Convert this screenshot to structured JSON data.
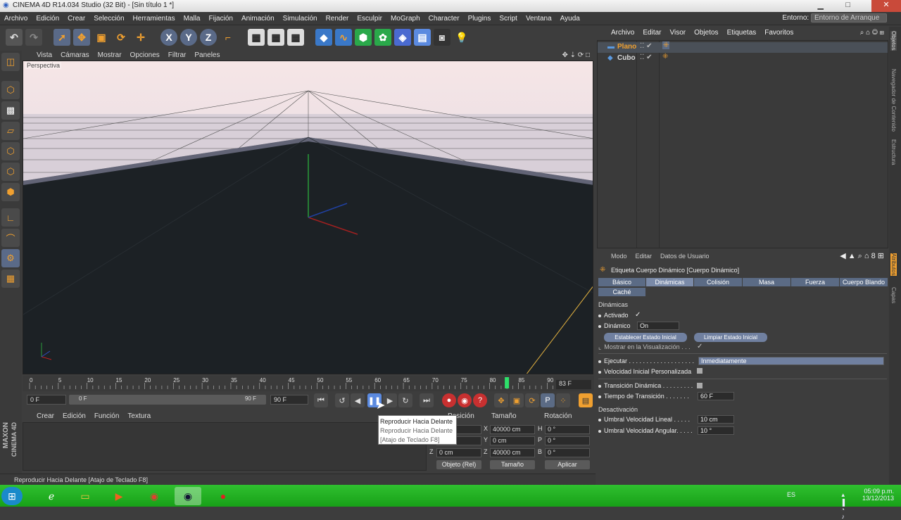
{
  "titlebar": {
    "title": "CINEMA 4D R14.034 Studio (32 Bit) - [Sin título 1 *]"
  },
  "menubar": {
    "items": [
      "Archivo",
      "Edición",
      "Crear",
      "Selección",
      "Herramientas",
      "Malla",
      "Fijación",
      "Animación",
      "Simulación",
      "Render",
      "Esculpir",
      "MoGraph",
      "Character",
      "Plugins",
      "Script",
      "Ventana",
      "Ayuda"
    ],
    "entorno_label": "Entorno:",
    "entorno_value": "Entorno de Arranque"
  },
  "viewport": {
    "menu": [
      "Vista",
      "Cámaras",
      "Mostrar",
      "Opciones",
      "Filtrar",
      "Paneles"
    ],
    "label": "Perspectiva"
  },
  "timeline": {
    "ticks": [
      "0",
      "5",
      "10",
      "15",
      "20",
      "25",
      "30",
      "35",
      "40",
      "45",
      "50",
      "55",
      "60",
      "65",
      "70",
      "75",
      "80",
      "85",
      "90"
    ],
    "current_frame": "83 F",
    "start_field": "0 F",
    "slider_start": "0 F",
    "slider_end": "90 F",
    "end_field": "90 F",
    "playhead_frame": 83
  },
  "materials": {
    "menu": [
      "Crear",
      "Edición",
      "Función",
      "Textura"
    ],
    "logo_top": "MAXON",
    "logo_bottom": "CINEMA 4D"
  },
  "coords": {
    "headers": [
      "Posición",
      "Tamaño",
      "Rotación"
    ],
    "rows": [
      {
        "axis": "X",
        "pos": "0 cm",
        "sizeaxis": "X",
        "size": "40000 cm",
        "rotaxis": "H",
        "rot": "0 °"
      },
      {
        "axis": "Y",
        "pos": "0 cm",
        "sizeaxis": "Y",
        "size": "0 cm",
        "rotaxis": "P",
        "rot": "0 °"
      },
      {
        "axis": "Z",
        "pos": "0 cm",
        "sizeaxis": "Z",
        "size": "40000 cm",
        "rotaxis": "B",
        "rot": "0 °"
      }
    ],
    "mode": "Objeto (Rel)",
    "size_mode": "Tamaño",
    "apply": "Aplicar"
  },
  "tooltip": {
    "line1": "Reproducir Hacia Delante",
    "line2": "Reproducir Hacia Delante",
    "line3": "[Atajo de Teclado F8]"
  },
  "status": "Reproducir Hacia Delante [Atajo de Teclado F8]",
  "objects": {
    "menu": [
      "Archivo",
      "Editar",
      "Visor",
      "Objetos",
      "Etiquetas",
      "Favoritos"
    ],
    "items": [
      {
        "name": "Plano"
      },
      {
        "name": "Cubo"
      }
    ]
  },
  "sidetabs": [
    "Objetos",
    "Navegador de Contenido",
    "Estructura",
    "Atributos",
    "Capas"
  ],
  "attributes": {
    "menu": [
      "Modo",
      "Editar",
      "Datos de Usuario"
    ],
    "title": "Etiqueta Cuerpo Dinámico [Cuerpo Dinámico]",
    "tabs": [
      "Básico",
      "Dinámicas",
      "Colisión",
      "Masa",
      "Fuerza",
      "Cuerpo Blando",
      "Caché"
    ],
    "section_dynamics": "Dinámicas",
    "activado_label": "Activado",
    "activado_check": "✓",
    "dinamico_label": "Dinámico",
    "dinamico_value": "On",
    "btn_establecer": "Establecer Estado Inicial",
    "btn_limpiar": "Limpiar Estado Inicial",
    "mostrar_label": "Mostrar en la Visualización . . .",
    "mostrar_check": "✓",
    "ejecutar_label": "Ejecutar . . . . . . . . . . . . . . . . . . .",
    "ejecutar_value": "Inmediatamente",
    "velocidad_label": "Velocidad Inicial Personalizada",
    "transicion_label": "Transición Dinámica . . . . . . . . .",
    "tiempo_label": "Tiempo de Transición . . . . . . .",
    "tiempo_value": "60 F",
    "section_desact": "Desactivación",
    "umbral_lineal_label": "Umbral Velocidad Lineal . . . . .",
    "umbral_lineal_value": "10 cm",
    "umbral_angular_label": "Umbral Velocidad Angular. . . . .",
    "umbral_angular_value": "10 °"
  },
  "taskbar": {
    "lang": "ES",
    "time": "05:09 p.m.",
    "date": "13/12/2013"
  },
  "colors": {
    "accent": "#f0a030",
    "tabblue": "#5b6b85",
    "taskbar": "#22b022"
  }
}
